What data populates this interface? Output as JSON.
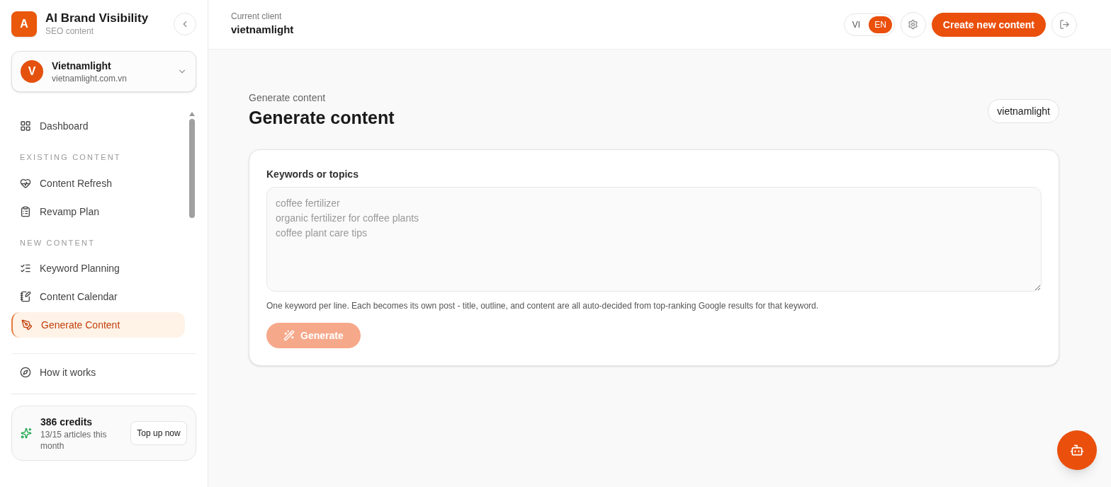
{
  "brand": {
    "logo_letter": "A",
    "title": "AI Brand Visibility",
    "subtitle": "SEO content"
  },
  "client_switcher": {
    "avatar_letter": "V",
    "name": "Vietnamlight",
    "domain": "vietnamlight.com.vn"
  },
  "nav": [
    {
      "kind": "item",
      "label": "Dashboard",
      "selected": false
    },
    {
      "kind": "heading",
      "label": "EXISTING CONTENT"
    },
    {
      "kind": "item",
      "label": "Content Refresh",
      "selected": false
    },
    {
      "kind": "item",
      "label": "Revamp Plan",
      "selected": false
    },
    {
      "kind": "heading",
      "label": "NEW CONTENT"
    },
    {
      "kind": "item",
      "label": "Keyword Planning",
      "selected": false
    },
    {
      "kind": "item",
      "label": "Content Calendar",
      "selected": false
    },
    {
      "kind": "item",
      "label": "Generate Content",
      "selected": true
    }
  ],
  "help_link": "How it works",
  "credits": {
    "title": "386 credits",
    "subtitle": "13/15 articles this month",
    "button": "Top up now"
  },
  "header": {
    "caption": "Current client",
    "client": "vietnamlight",
    "languages": [
      {
        "label": "VI",
        "selected": false
      },
      {
        "label": "EN",
        "selected": true
      }
    ],
    "create_button": "Create new content"
  },
  "page": {
    "breadcrumb": "Generate content",
    "title": "Generate content",
    "client_chip": "vietnamlight"
  },
  "form": {
    "label": "Keywords or topics",
    "placeholder": "coffee fertilizer\norganic fertilizer for coffee plants\ncoffee plant care tips",
    "hint": "One keyword per line. Each becomes its own post - title, outline, and content are all auto-decided from top-ranking Google results for that keyword.",
    "button": "Generate",
    "button_disabled": true
  }
}
